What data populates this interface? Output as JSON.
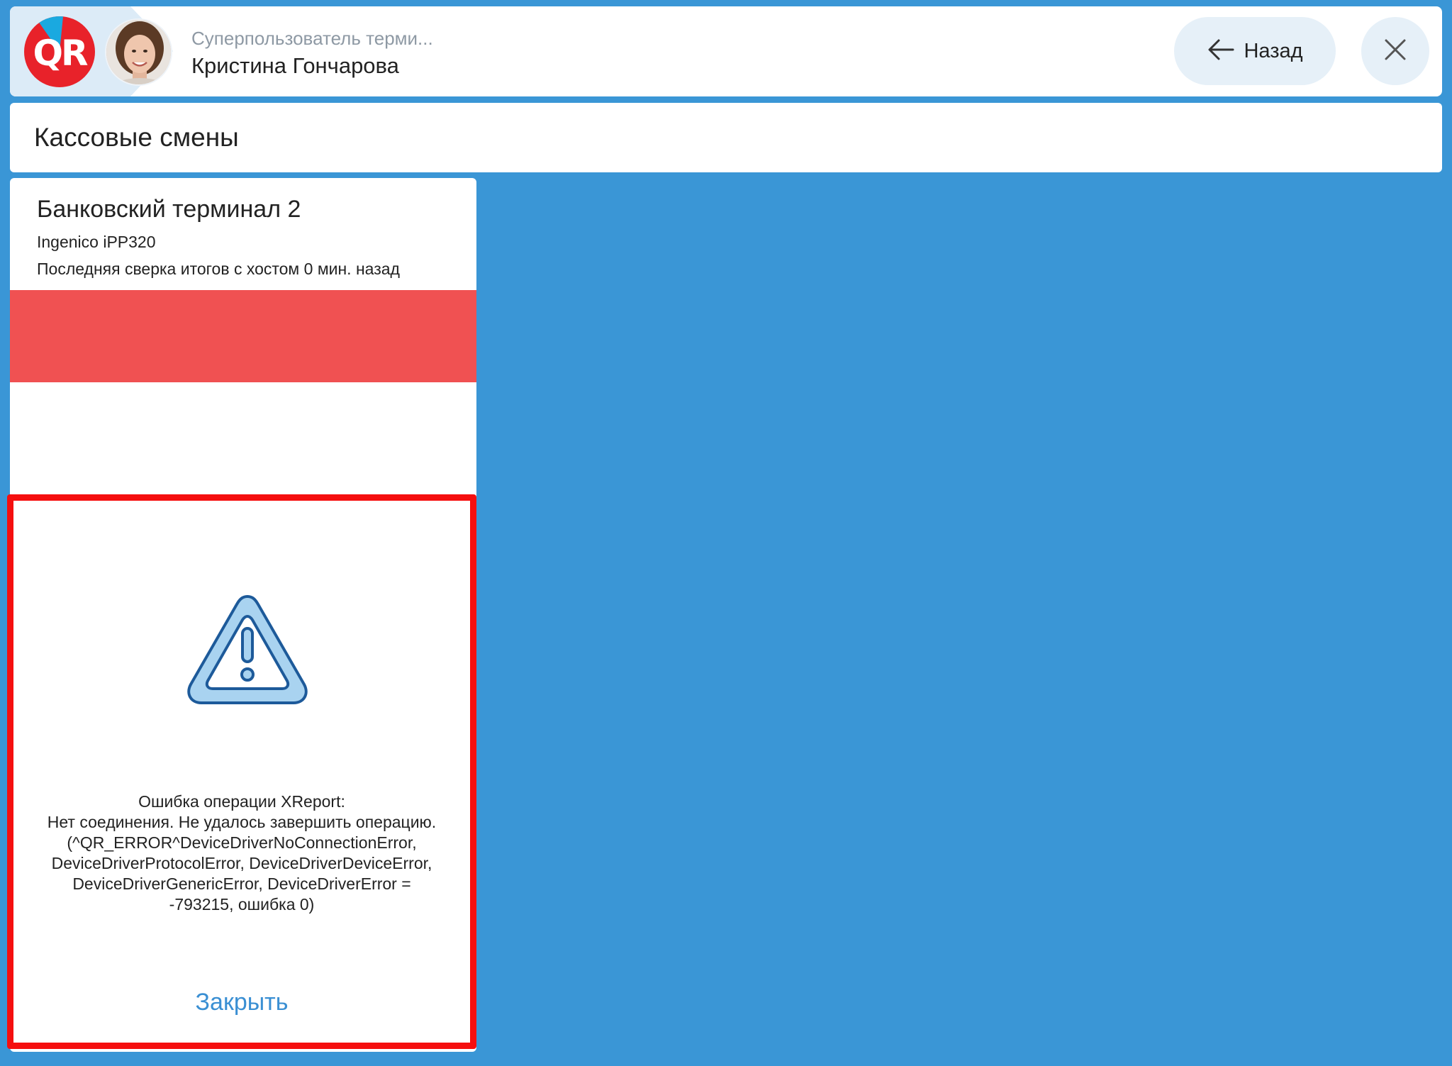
{
  "header": {
    "logo_text": "QR",
    "user_role": "Суперпользователь терми...",
    "user_name": "Кристина Гончарова",
    "back_label": "Назад"
  },
  "section": {
    "title": "Кассовые смены"
  },
  "terminal_card": {
    "title": "Банковский терминал 2",
    "model": "Ingenico iPP320",
    "last_reconciliation": "Последняя сверка итогов с хостом 0 мин. назад",
    "status_color": "#f05152"
  },
  "error_dialog": {
    "icon": "warning-icon",
    "lines": [
      "Ошибка операции XReport:",
      "Нет соединения. Не удалось завершить операцию.",
      "(^QR_ERROR^DeviceDriverNoConnectionError,",
      "DeviceDriverProtocolError, DeviceDriverDeviceError,",
      "DeviceDriverGenericError, DeviceDriverError =",
      "-793215, ошибка 0)"
    ],
    "close_label": "Закрыть"
  },
  "colors": {
    "background": "#3a96d6",
    "accent_link": "#3a8fd3",
    "dialog_border": "#f50f0f",
    "logo_red": "#e8222a",
    "logo_blue": "#1aa9e0"
  }
}
